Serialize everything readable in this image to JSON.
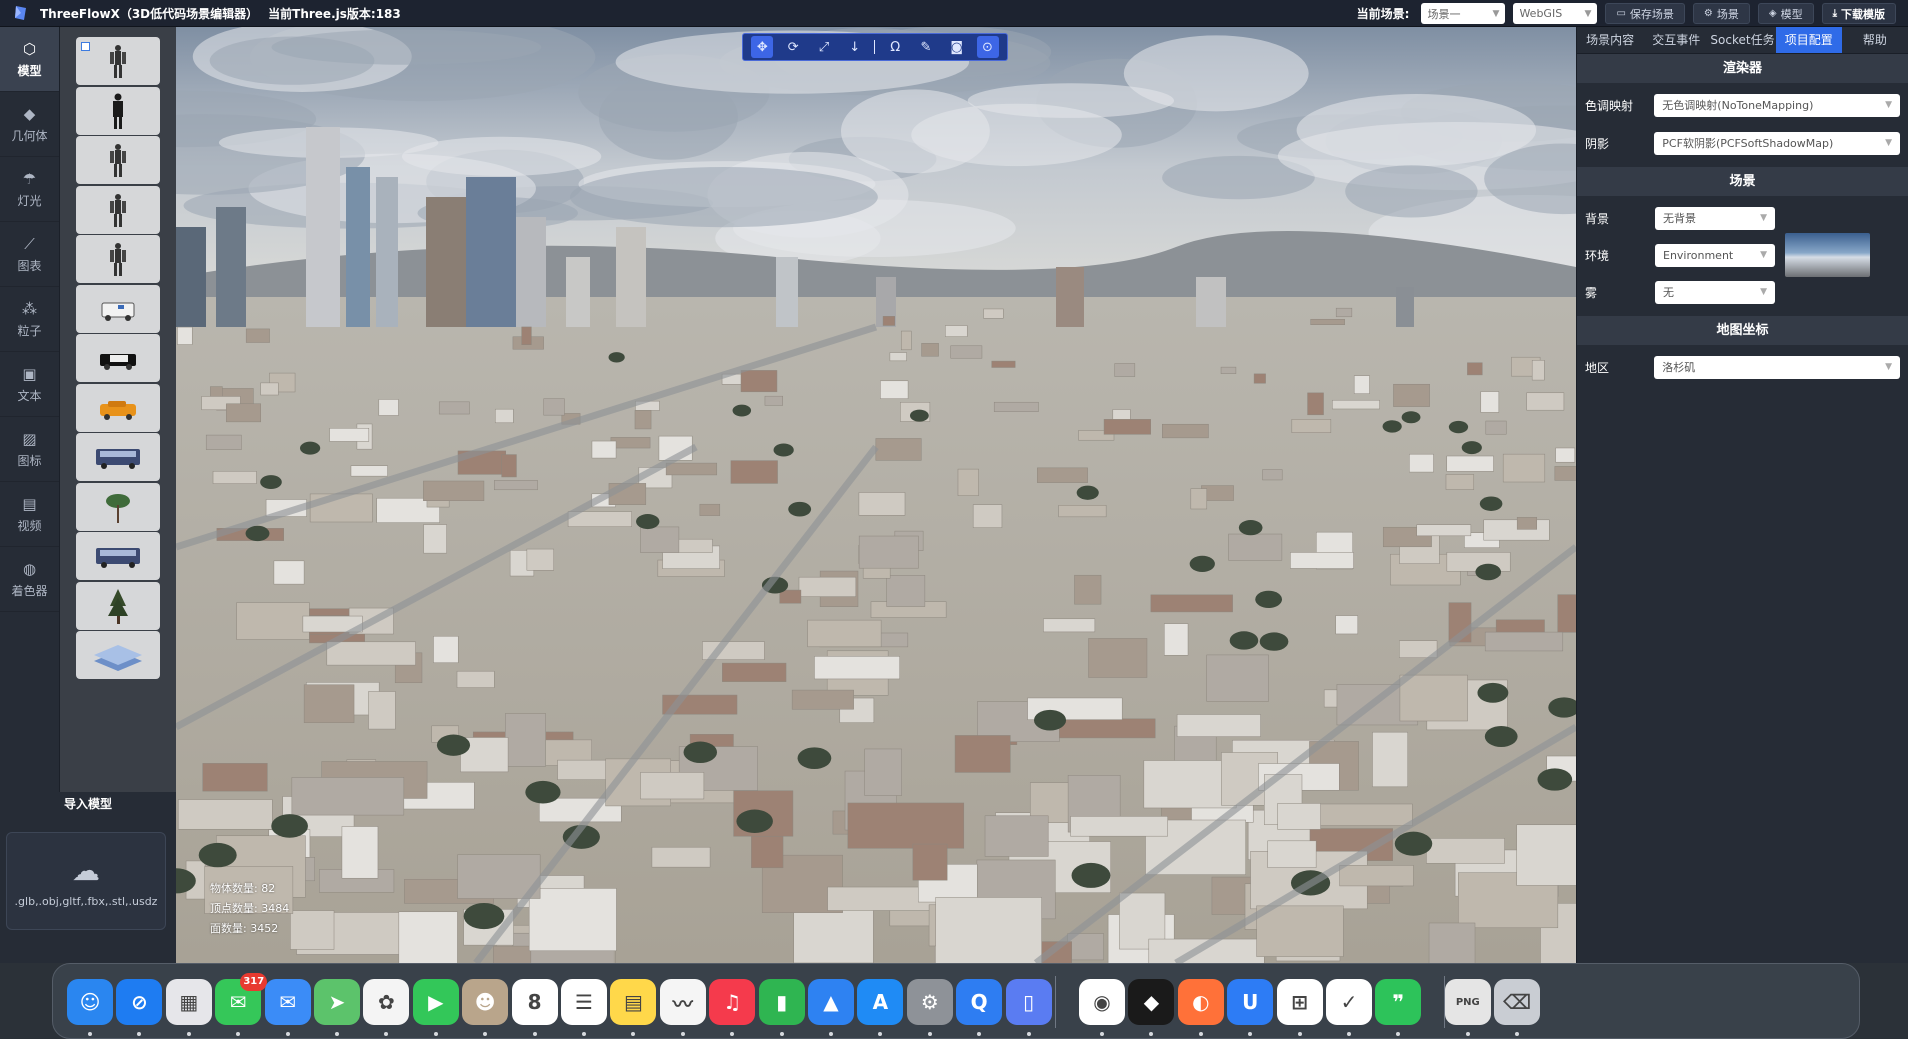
{
  "topbar": {
    "app_title": "ThreeFlowX（3D低代码场景编辑器）",
    "version_text": "当前Three.js版本:183",
    "scene_label": "当前场景:",
    "scene_select": "场景一",
    "mode_select": "WebGIS",
    "save_scene": "保存场景",
    "scene_btn": "场景",
    "model_btn": "模型",
    "download_template": "下载模版"
  },
  "rail": {
    "items": [
      {
        "label": "模型",
        "icon": "cube-icon"
      },
      {
        "label": "几何体",
        "icon": "geometry-icon"
      },
      {
        "label": "灯光",
        "icon": "light-icon"
      },
      {
        "label": "图表",
        "icon": "chart-icon"
      },
      {
        "label": "粒子",
        "icon": "particle-icon"
      },
      {
        "label": "文本",
        "icon": "text-icon"
      },
      {
        "label": "图标",
        "icon": "image-icon"
      },
      {
        "label": "视频",
        "icon": "video-icon"
      },
      {
        "label": "着色器",
        "icon": "palette-icon"
      }
    ]
  },
  "models": {
    "items": [
      {
        "name": "female-character-thumbnail"
      },
      {
        "name": "suited-man-thumbnail"
      },
      {
        "name": "dark-character-thumbnail"
      },
      {
        "name": "blue-character-thumbnail"
      },
      {
        "name": "robot-character-thumbnail"
      },
      {
        "name": "ambulance-thumbnail"
      },
      {
        "name": "police-car-thumbnail"
      },
      {
        "name": "taxi-thumbnail"
      },
      {
        "name": "bus-thumbnail"
      },
      {
        "name": "small-tree-thumbnail"
      },
      {
        "name": "bush-tree-thumbnail"
      },
      {
        "name": "pine-tree-thumbnail"
      },
      {
        "name": "building-thumbnail"
      }
    ]
  },
  "import": {
    "title": "导入模型",
    "formats": ".glb,.obj,gltf,.fbx,.stl,.usdz"
  },
  "viewport": {
    "stats": {
      "objects": "物体数量: 82",
      "vertices": "顶点数量: 3484",
      "faces": "面数量: 3452"
    }
  },
  "toolbar": {
    "tools": [
      {
        "name": "move-tool-icon",
        "glyph": "✥",
        "active": true
      },
      {
        "name": "rotate-tool-icon",
        "glyph": "⟳",
        "active": false
      },
      {
        "name": "scale-tool-icon",
        "glyph": "⤢",
        "active": false
      },
      {
        "name": "drop-tool-icon",
        "glyph": "↓",
        "active": false
      },
      {
        "name": "separator",
        "glyph": "",
        "active": false
      },
      {
        "name": "magnet-tool-icon",
        "glyph": "Ω",
        "active": false
      },
      {
        "name": "edit-tool-icon",
        "glyph": "✎",
        "active": false
      },
      {
        "name": "camera-tool-icon",
        "glyph": "◙",
        "active": false
      },
      {
        "name": "toggle-view-icon",
        "glyph": "⊙",
        "active": true
      }
    ]
  },
  "props": {
    "tabs": [
      "场景内容",
      "交互事件",
      "Socket任务",
      "项目配置",
      "帮助"
    ],
    "active_tab": 3,
    "renderer": {
      "title": "渲染器",
      "tone_label": "色调映射",
      "tone_value": "无色调映射(NoToneMapping)",
      "shadow_label": "阴影",
      "shadow_value": "PCF软阴影(PCFSoftShadowMap)"
    },
    "scene": {
      "title": "场景",
      "bg_label": "背景",
      "bg_value": "无背景",
      "env_label": "环境",
      "env_value": "Environment",
      "fog_label": "雾",
      "fog_value": "无"
    },
    "map": {
      "title": "地图坐标",
      "region_label": "地区",
      "region_value": "洛杉矶"
    }
  },
  "dock": {
    "items": [
      {
        "name": "finder-icon",
        "glyph": "☺",
        "color": "#2a86f0"
      },
      {
        "name": "safari-icon",
        "glyph": "⊘",
        "color": "#1e7cf2"
      },
      {
        "name": "launchpad-icon",
        "glyph": "▦",
        "color": "#e6e6ea"
      },
      {
        "name": "messages-icon",
        "glyph": "✉",
        "color": "#35c759",
        "badge": "317"
      },
      {
        "name": "mail-icon",
        "glyph": "✉",
        "color": "#3b8cf7"
      },
      {
        "name": "maps-icon",
        "glyph": "➤",
        "color": "#5cc36b"
      },
      {
        "name": "photos-icon",
        "glyph": "✿",
        "color": "#f4f4f4"
      },
      {
        "name": "facetime-icon",
        "glyph": "▶",
        "color": "#33c759"
      },
      {
        "name": "contacts-icon",
        "glyph": "☻",
        "color": "#b9a58b"
      },
      {
        "name": "calendar-icon",
        "glyph": "8",
        "color": "#ffffff"
      },
      {
        "name": "reminders-icon",
        "glyph": "☰",
        "color": "#ffffff"
      },
      {
        "name": "notes-icon",
        "glyph": "▤",
        "color": "#ffd84a"
      },
      {
        "name": "freeform-icon",
        "glyph": "〰",
        "color": "#f5f5f5"
      },
      {
        "name": "music-icon",
        "glyph": "♫",
        "color": "#f53a4c"
      },
      {
        "name": "numbers-icon",
        "glyph": "▮",
        "color": "#2fb551"
      },
      {
        "name": "keynote-icon",
        "glyph": "▲",
        "color": "#2e82f2"
      },
      {
        "name": "app-store-icon",
        "glyph": "A",
        "color": "#1f8bf5"
      },
      {
        "name": "system-settings-icon",
        "glyph": "⚙",
        "color": "#8e9298"
      },
      {
        "name": "qq-browser-icon",
        "glyph": "Q",
        "color": "#2e7df2"
      },
      {
        "name": "phone-mirror-icon",
        "glyph": "▯",
        "color": "#5a7cf2"
      },
      {
        "name": "chrome-icon",
        "glyph": "◉",
        "color": "#ffffff"
      },
      {
        "name": "cursor-icon",
        "glyph": "◆",
        "color": "#1a1a1a"
      },
      {
        "name": "firefox-icon",
        "glyph": "◐",
        "color": "#ff7139"
      },
      {
        "name": "wechat-work-icon",
        "glyph": "U",
        "color": "#2d7cf5"
      },
      {
        "name": "windows-app-icon",
        "glyph": "⊞",
        "color": "#ffffff"
      },
      {
        "name": "feishu-icon",
        "glyph": "✓",
        "color": "#ffffff"
      },
      {
        "name": "wechat-icon",
        "glyph": "❞",
        "color": "#2dc35a"
      },
      {
        "name": "png-file-icon",
        "glyph": "PNG",
        "color": "#e5e5e5"
      },
      {
        "name": "trash-icon",
        "glyph": "⌫",
        "color": "#c9cdd3"
      }
    ]
  }
}
